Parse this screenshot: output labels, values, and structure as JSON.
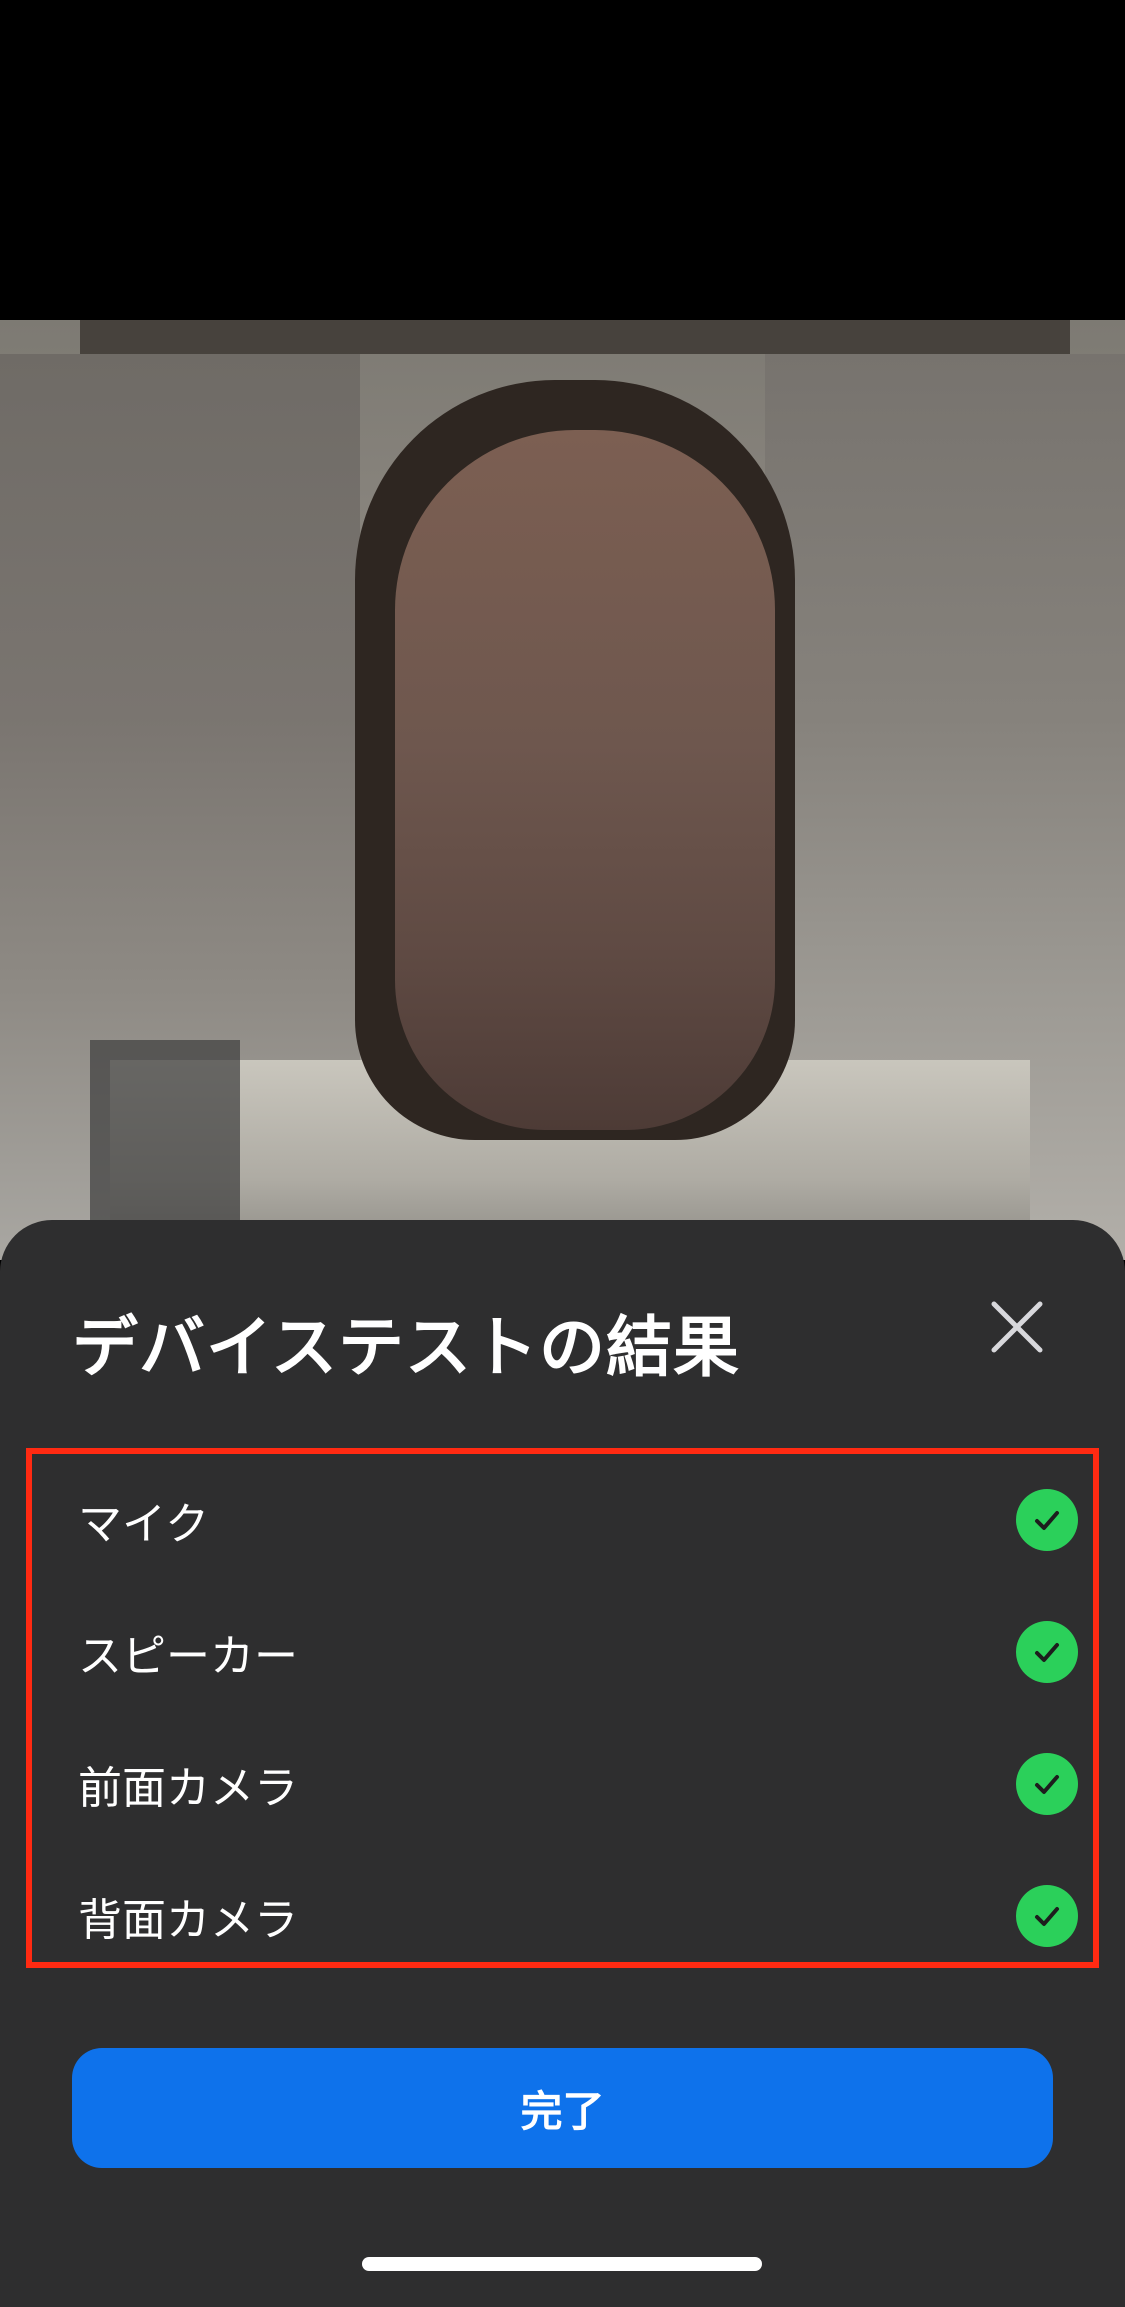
{
  "colors": {
    "sheet_background": "#2e2e2f",
    "accent_button": "#0e72eb",
    "check_green": "#2bd05a",
    "highlight_border": "#ff2a12"
  },
  "sheet": {
    "title": "デバイステストの結果",
    "close_icon": "close-icon",
    "results": [
      {
        "label": "マイク",
        "status_icon": "check-icon"
      },
      {
        "label": "スピーカー",
        "status_icon": "check-icon"
      },
      {
        "label": "前面カメラ",
        "status_icon": "check-icon"
      },
      {
        "label": "背面カメラ",
        "status_icon": "check-icon"
      }
    ],
    "done_label": "完了"
  }
}
